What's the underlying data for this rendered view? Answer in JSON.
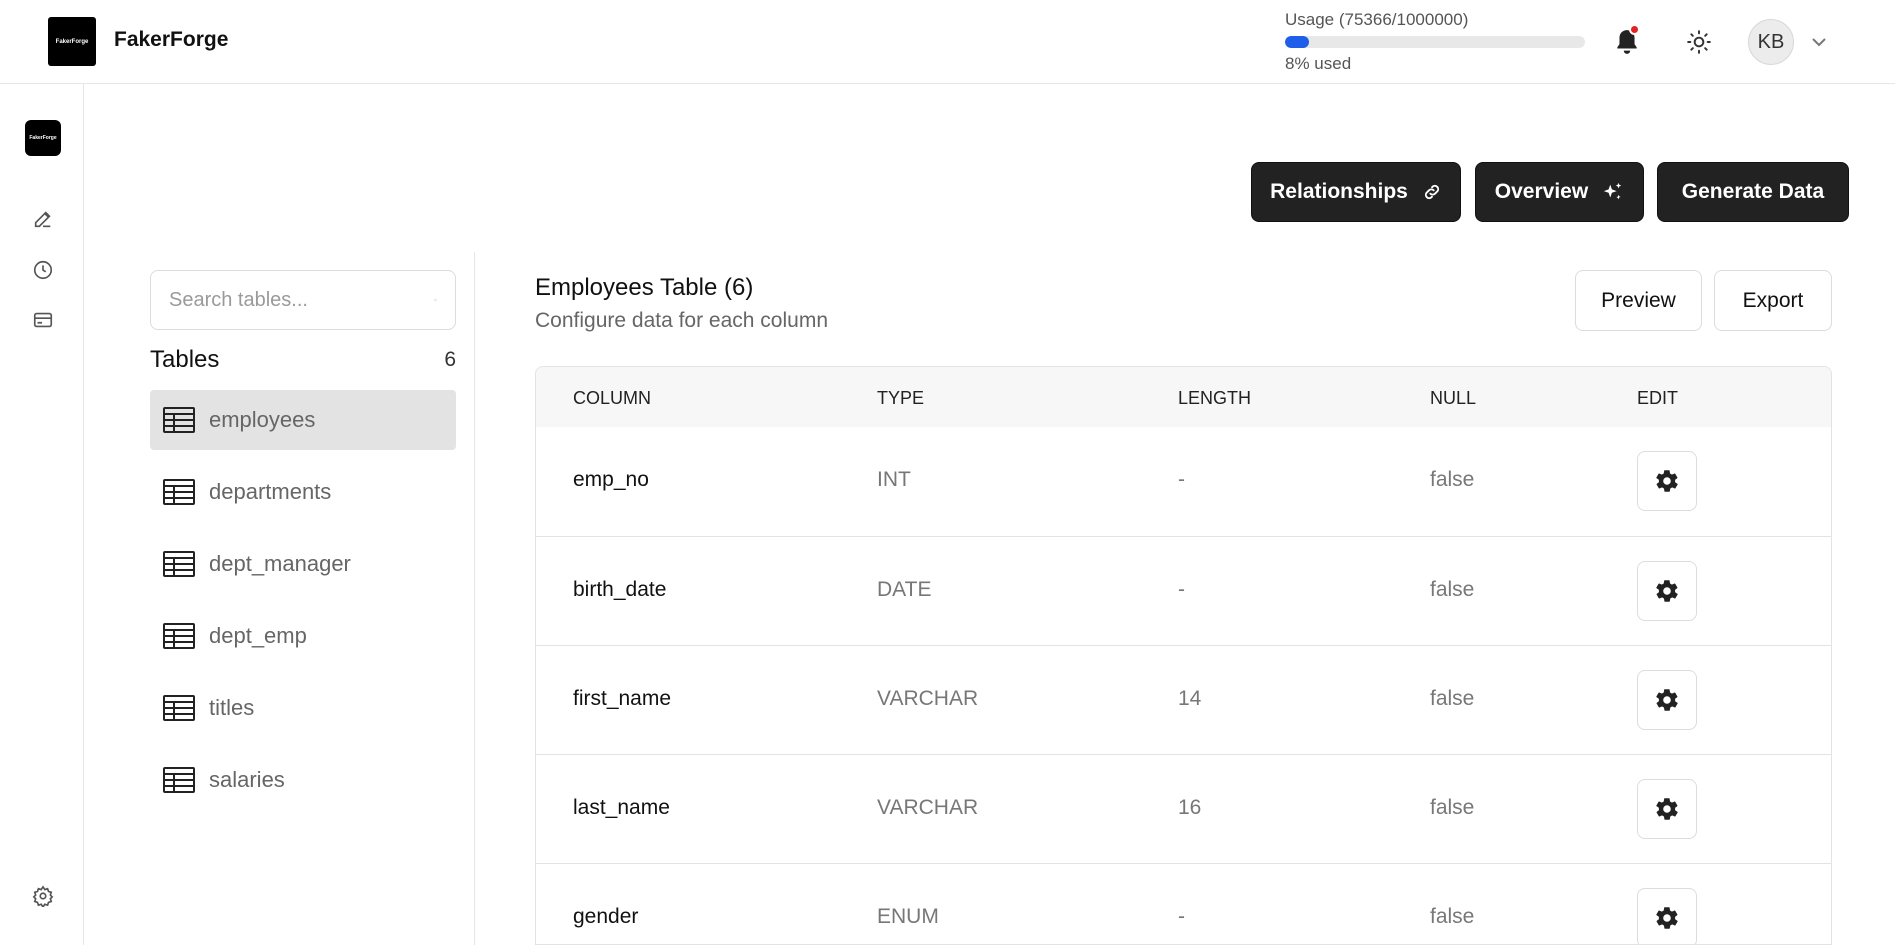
{
  "app": {
    "name": "FakerForge",
    "logo_text": "FakerForge"
  },
  "usage": {
    "label": "Usage (75366/1000000)",
    "percent_text": "8% used",
    "fraction": 0.08,
    "bar_color": "#1f5ee8"
  },
  "header": {
    "avatar_initials": "KB",
    "icons": [
      "bell-icon",
      "sun-icon",
      "chevron-down-icon"
    ],
    "notification_dot_color": "#e02424"
  },
  "rail": {
    "icons": [
      "edit-icon",
      "history-icon",
      "card-icon",
      "settings-icon"
    ]
  },
  "actions": {
    "relationships": "Relationships",
    "overview": "Overview",
    "generate": "Generate Data"
  },
  "tables_panel": {
    "search_placeholder": "Search tables...",
    "title": "Tables",
    "count": "6",
    "items": [
      {
        "label": "employees",
        "active": true
      },
      {
        "label": "departments",
        "active": false
      },
      {
        "label": "dept_manager",
        "active": false
      },
      {
        "label": "dept_emp",
        "active": false
      },
      {
        "label": "titles",
        "active": false
      },
      {
        "label": "salaries",
        "active": false
      }
    ]
  },
  "main": {
    "title": "Employees Table (6)",
    "subtitle": "Configure data for each column",
    "preview": "Preview",
    "export": "Export",
    "columns": {
      "column": "COLUMN",
      "type": "TYPE",
      "length": "LENGTH",
      "null": "NULL",
      "edit": "EDIT"
    },
    "rows": [
      {
        "column": "emp_no",
        "type": "INT",
        "length": "-",
        "null": "false"
      },
      {
        "column": "birth_date",
        "type": "DATE",
        "length": "-",
        "null": "false"
      },
      {
        "column": "first_name",
        "type": "VARCHAR",
        "length": "14",
        "null": "false"
      },
      {
        "column": "last_name",
        "type": "VARCHAR",
        "length": "16",
        "null": "false"
      },
      {
        "column": "gender",
        "type": "ENUM",
        "length": "-",
        "null": "false"
      }
    ]
  }
}
